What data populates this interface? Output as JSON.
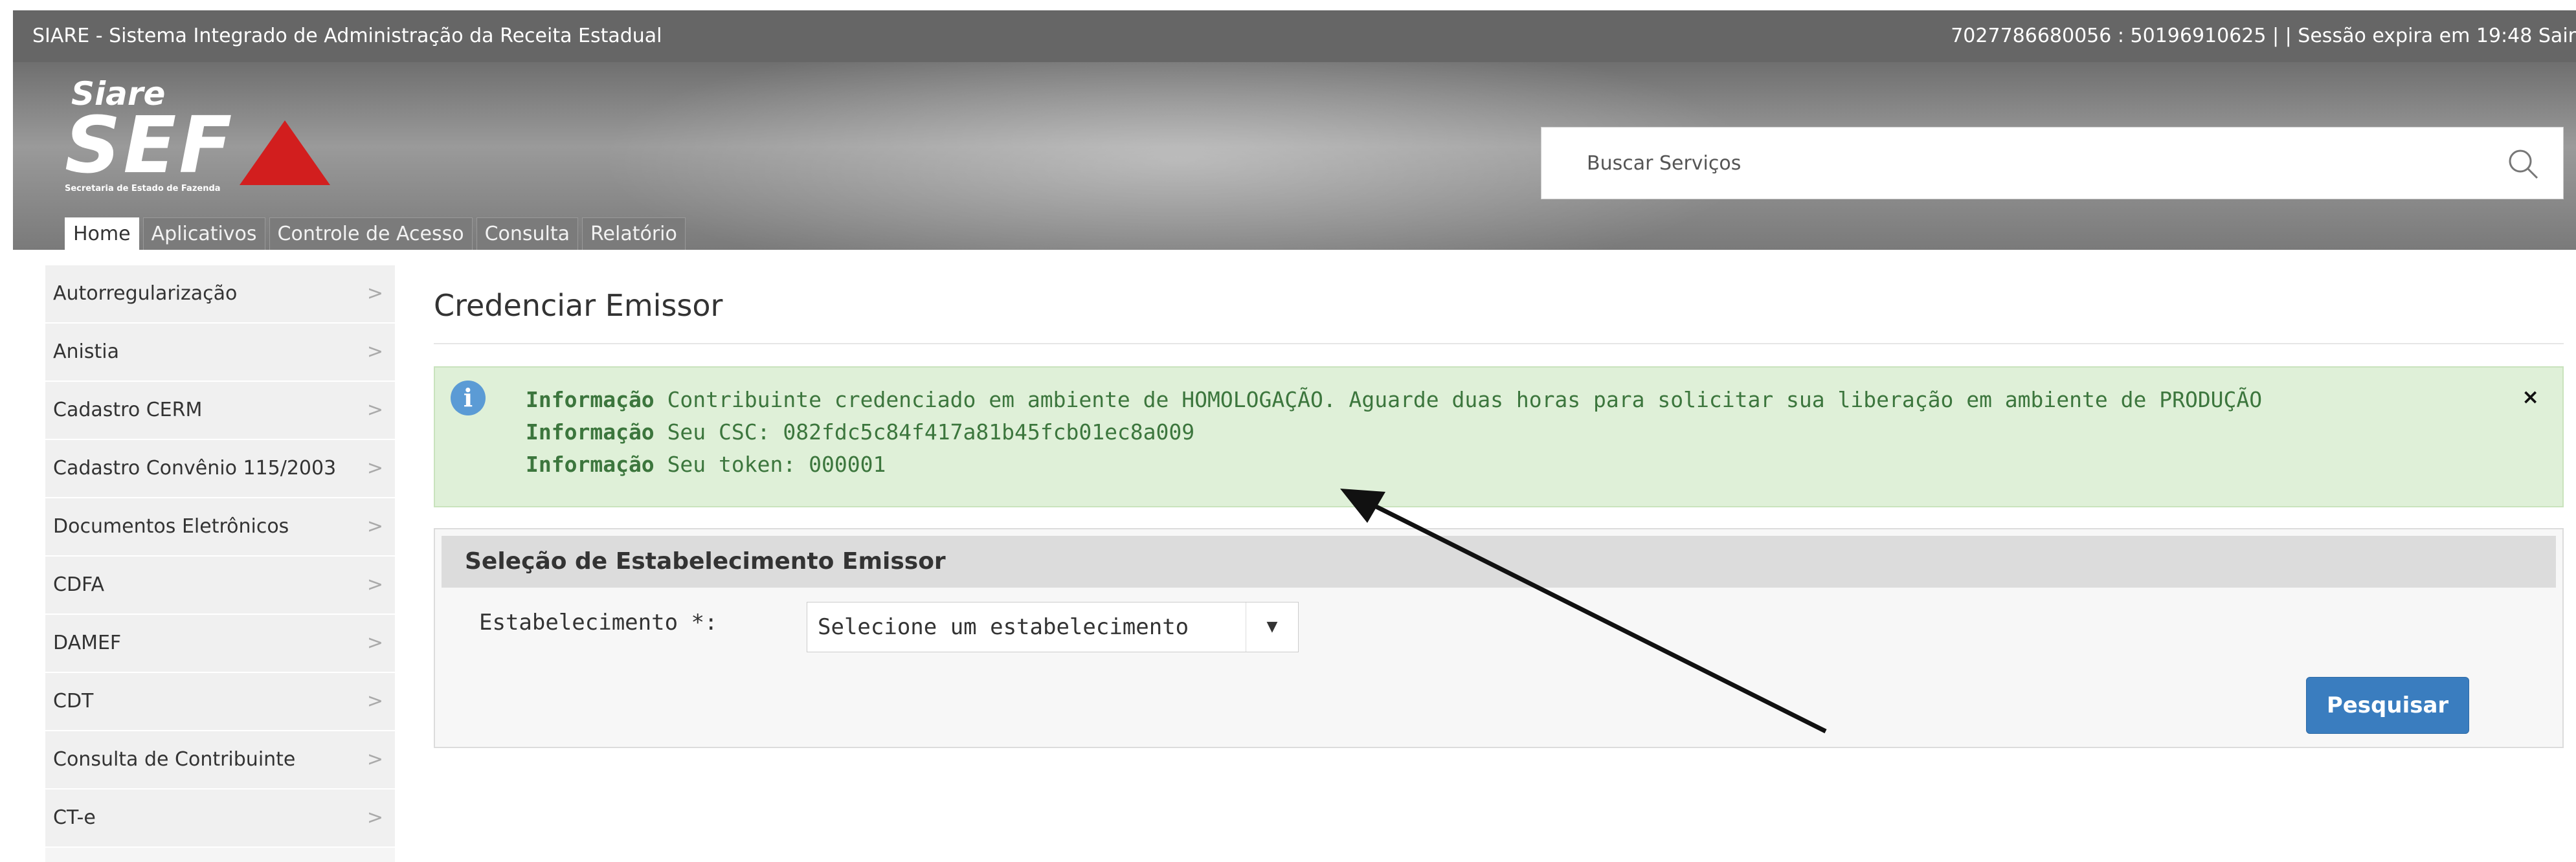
{
  "topbar": {
    "system_title": "SIARE - Sistema Integrado de Administração da Receita Estadual",
    "session_info": "7027786680056 : 50196910625 | | Sessão expira em 19:48",
    "logout": "Sair"
  },
  "logo": {
    "brand_top": "Siare",
    "brand_main": "SEF",
    "brand_sub": "Secretaria de Estado de Fazenda",
    "accent_color": "#d21e1e"
  },
  "search": {
    "placeholder": "Buscar Serviços",
    "icon": "search-icon"
  },
  "tabs": [
    {
      "label": "Home",
      "active": true
    },
    {
      "label": "Aplicativos",
      "active": false
    },
    {
      "label": "Controle de Acesso",
      "active": false
    },
    {
      "label": "Consulta",
      "active": false
    },
    {
      "label": "Relatório",
      "active": false
    }
  ],
  "sidebar": {
    "items": [
      {
        "label": "Autorregularização"
      },
      {
        "label": "Anistia"
      },
      {
        "label": "Cadastro CERM"
      },
      {
        "label": "Cadastro Convênio 115/2003"
      },
      {
        "label": "Documentos Eletrônicos"
      },
      {
        "label": "CDFA"
      },
      {
        "label": "DAMEF"
      },
      {
        "label": "CDT"
      },
      {
        "label": "Consulta de Contribuinte"
      },
      {
        "label": "CT-e"
      }
    ],
    "chevron": ">"
  },
  "main": {
    "title": "Credenciar Emissor",
    "alert": {
      "prefix": "Informação",
      "messages": [
        "Contribuinte credenciado em ambiente de HOMOLOGAÇÃO. Aguarde duas horas para solicitar sua liberação em ambiente de PRODUÇÃO",
        "Seu CSC: 082fdc5c84f417a81b45fcb01ec8a009",
        "Seu token: 000001"
      ],
      "close": "×",
      "background_color": "#dff0d8",
      "text_color": "#3c763d"
    },
    "panel": {
      "heading": "Seleção de Estabelecimento Emissor",
      "field_label": "Estabelecimento *:",
      "select_value": "Selecione um estabelecimento",
      "submit": "Pesquisar",
      "button_color": "#3a7dbf"
    }
  }
}
